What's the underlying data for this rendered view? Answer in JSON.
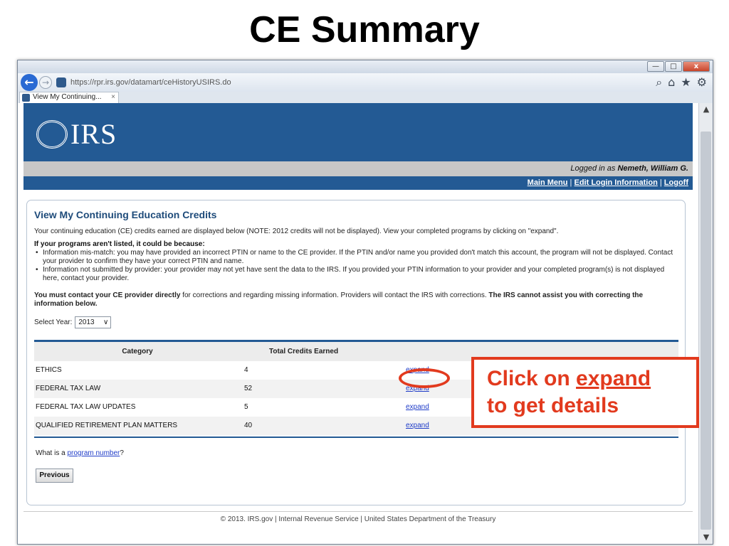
{
  "slide": {
    "title": "CE Summary"
  },
  "browser": {
    "url": "https://rpr.irs.gov/datamart/ceHistoryUSIRS.do",
    "tab_title": "View My Continuing...",
    "tab_close": "×",
    "win_min": "—",
    "win_max": "□",
    "win_close": "x",
    "back_glyph": "←",
    "fwd_glyph": "→",
    "icon_search": "⌕",
    "icon_home": "⌂",
    "icon_star": "★",
    "icon_gear": "⚙",
    "scroll_up": "▲",
    "scroll_down": "▼"
  },
  "site": {
    "logo_text": "IRS",
    "logged_in_prefix": "Logged in as ",
    "logged_in_user": "Nemeth, William G.",
    "menu": {
      "main_menu": "Main Menu",
      "sep1": " | ",
      "edit_login": "Edit Login Information",
      "sep2": " | ",
      "logoff": "Logoff"
    }
  },
  "page": {
    "heading": "View My Continuing Education Credits",
    "intro": "Your continuing education (CE) credits earned are displayed below (NOTE: 2012 credits will not be displayed). View your completed programs by clicking on \"expand\".",
    "reasons_title": "If your programs aren't listed, it could be because:",
    "reasons": [
      "Information mis-match: you may have provided an incorrect PTIN or name to the CE provider. If the PTIN and/or name you provided don't match this account, the program will not be displayed. Contact your provider to confirm they have your correct PTIN and name.",
      "Information not submitted by provider: your provider may not yet have sent the data to the IRS. If you provided your PTIN information to your provider and your completed program(s) is not displayed here, contact your provider."
    ],
    "contact_bold": "You must contact your CE provider directly",
    "contact_text": " for corrections and regarding missing information. Providers will contact the IRS with corrections. ",
    "contact_bold2": "The IRS cannot assist you with correcting the information below.",
    "select_year_label": "Select Year:",
    "select_year_value": "2013",
    "select_arrow": "∨",
    "table": {
      "headers": {
        "category": "Category",
        "total": "Total Credits Earned"
      },
      "rows": [
        {
          "category": "ETHICS",
          "credits": "4",
          "action": "expand"
        },
        {
          "category": "FEDERAL TAX LAW",
          "credits": "52",
          "action": "expand"
        },
        {
          "category": "FEDERAL TAX LAW UPDATES",
          "credits": "5",
          "action": "expand"
        },
        {
          "category": "QUALIFIED RETIREMENT PLAN MATTERS",
          "credits": "40",
          "action": "expand"
        }
      ]
    },
    "program_q_prefix": "What is a ",
    "program_q_link": "program number",
    "program_q_suffix": "?",
    "previous_button": "Previous"
  },
  "footer": "© 2013. IRS.gov | Internal Revenue Service | United States Department of the Treasury",
  "callout": {
    "line1_prefix": "Click on ",
    "line1_link": "expand",
    "line2": "to get details"
  },
  "colors": {
    "header_blue": "#235a94",
    "callout_red": "#e23a1e",
    "link_blue": "#1f3cc8"
  }
}
